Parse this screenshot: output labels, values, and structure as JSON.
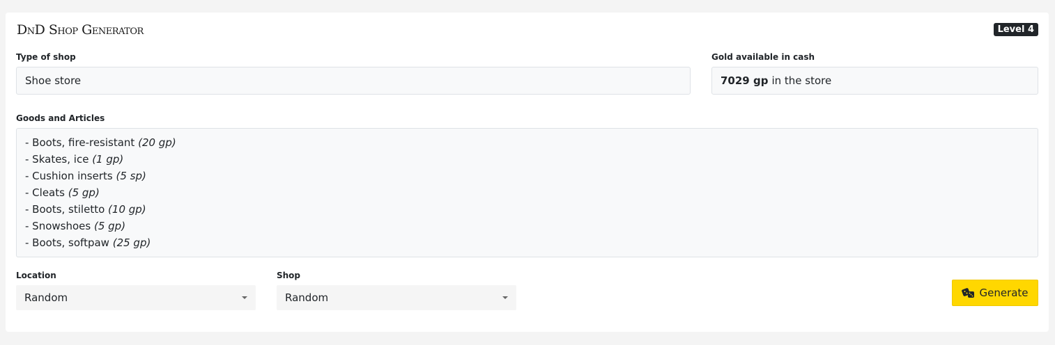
{
  "app": {
    "title": "DnD Shop Generator",
    "level_badge": "Level 4"
  },
  "shop_type": {
    "label": "Type of shop",
    "value": "Shoe store"
  },
  "gold": {
    "label": "Gold available in cash",
    "amount": "7029 gp",
    "suffix": "in the store"
  },
  "goods": {
    "label": "Goods and Articles",
    "items": [
      {
        "name": "- Boots, fire-resistant",
        "price": "(20 gp)"
      },
      {
        "name": "- Skates, ice",
        "price": "(1 gp)"
      },
      {
        "name": "- Cushion inserts",
        "price": "(5 sp)"
      },
      {
        "name": "- Cleats",
        "price": "(5 gp)"
      },
      {
        "name": "- Boots, stiletto",
        "price": "(10 gp)"
      },
      {
        "name": "- Snowshoes",
        "price": "(5 gp)"
      },
      {
        "name": "- Boots, softpaw",
        "price": "(25 gp)"
      }
    ]
  },
  "location": {
    "label": "Location",
    "selected": "Random"
  },
  "shop": {
    "label": "Shop",
    "selected": "Random"
  },
  "generate_button": {
    "label": "Generate",
    "icon": "dice-icon"
  },
  "colors": {
    "accent": "#ffd700",
    "badge_bg": "#212529",
    "field_bg": "#f8f9fa"
  }
}
